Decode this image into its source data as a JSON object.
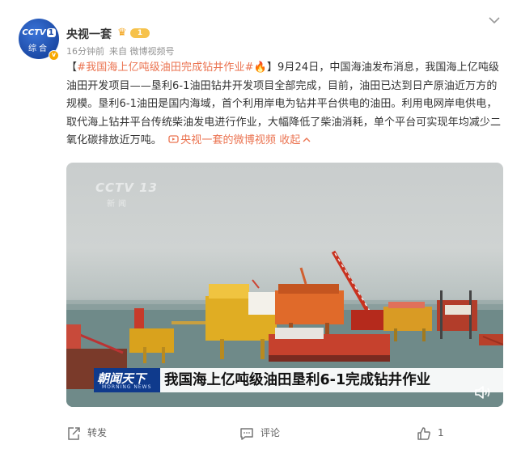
{
  "account": {
    "name": "央视一套",
    "avatar_top": "CCTV",
    "avatar_one": "1",
    "avatar_channel": "综合",
    "rank_label": "1",
    "time": "16分钟前",
    "source": "来自 微博视频号",
    "more_icon": "chevron-down-icon"
  },
  "post": {
    "hashtag": "#我国海上亿吨级油田完成钻井作业#",
    "bracket_open": "【",
    "bracket_close": "】",
    "body": "9月24日，中国海油发布消息，我国海上亿吨级油田开发项目——垦利6-1油田钻井开发项目全部完成，目前，油田已达到日产原油近万方的规模。垦利6-1油田是国内海域，首个利用岸电为钻井平台供电的油田。利用电网岸电供电，取代海上钻井平台传统柴油发电进行作业，大幅降低了柴油消耗，单个平台可实现年均减少二氧化碳排放近万吨。",
    "video_link": "央视一套的微博视频",
    "collapse": "收起"
  },
  "video": {
    "watermark": "CCTV 13",
    "watermark_sub": "新闻",
    "brand": "朝闻天下",
    "brand_sub": "MORNING NEWS",
    "caption": "我国海上亿吨级油田垦利6-1完成钻井作业"
  },
  "actions": {
    "repost": "转发",
    "comment": "评论",
    "like_count": "1"
  },
  "colors": {
    "link": "#eb7350",
    "brand_blue": "#0f3a8c"
  }
}
